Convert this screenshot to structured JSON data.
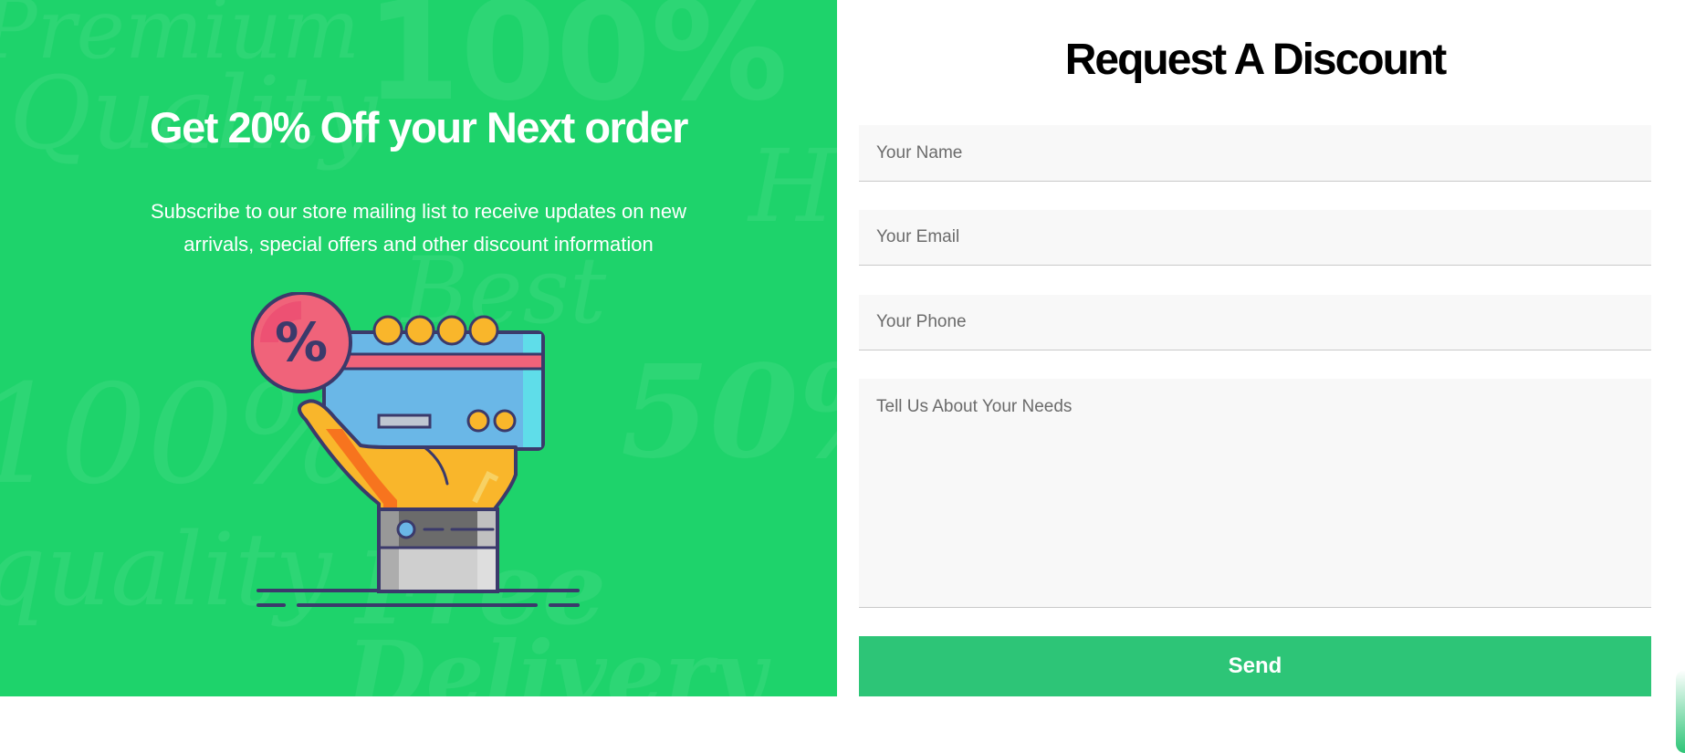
{
  "promo": {
    "title": "Get 20% Off your Next order",
    "subtitle": "Subscribe to our store mailing list to receive updates on new arrivals, special offers and other discount information",
    "illustration_icon": "hand-holding-card-discount-icon",
    "colors": {
      "background": "#1ed36b",
      "text": "#ffffff"
    }
  },
  "form": {
    "title": "Request A Discount",
    "name_placeholder": "Your Name",
    "email_placeholder": "Your Email",
    "phone_placeholder": "Your Phone",
    "needs_placeholder": "Tell Us About Your Needs",
    "send_label": "Send",
    "colors": {
      "field_bg": "#f8f8f8",
      "button": "#2dc577",
      "title": "#000000"
    }
  }
}
